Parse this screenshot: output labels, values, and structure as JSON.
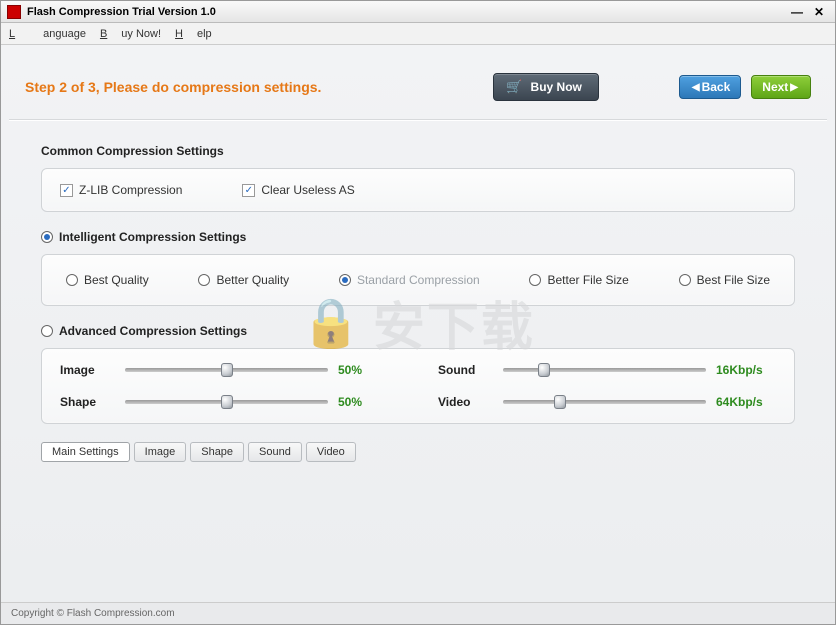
{
  "window": {
    "title": "Flash Compression Trial Version 1.0"
  },
  "menu": {
    "language": "Language",
    "buy": "Buy Now!",
    "help": "Help"
  },
  "header": {
    "step": "Step 2 of 3, Please do compression settings.",
    "buy_now": "Buy Now",
    "back": "Back",
    "next": "Next"
  },
  "common": {
    "title": "Common Compression Settings",
    "zlib": "Z-LIB Compression",
    "clearas": "Clear Useless AS"
  },
  "intelligent": {
    "title": "Intelligent Compression Settings",
    "options": [
      "Best Quality",
      "Better Quality",
      "Standard Compression",
      "Better File Size",
      "Best File Size"
    ],
    "selected": 2
  },
  "advanced": {
    "title": "Advanced Compression Settings",
    "sliders": {
      "image": {
        "label": "Image",
        "value": "50%",
        "pos": 50
      },
      "sound": {
        "label": "Sound",
        "value": "16Kbp/s",
        "pos": 20
      },
      "shape": {
        "label": "Shape",
        "value": "50%",
        "pos": 50
      },
      "video": {
        "label": "Video",
        "value": "64Kbp/s",
        "pos": 28
      }
    }
  },
  "tabs": {
    "items": [
      "Main Settings",
      "Image",
      "Shape",
      "Sound",
      "Video"
    ],
    "active": 0
  },
  "footer": {
    "copyright": "Copyright © Flash Compression.com"
  },
  "watermark": "安下载"
}
